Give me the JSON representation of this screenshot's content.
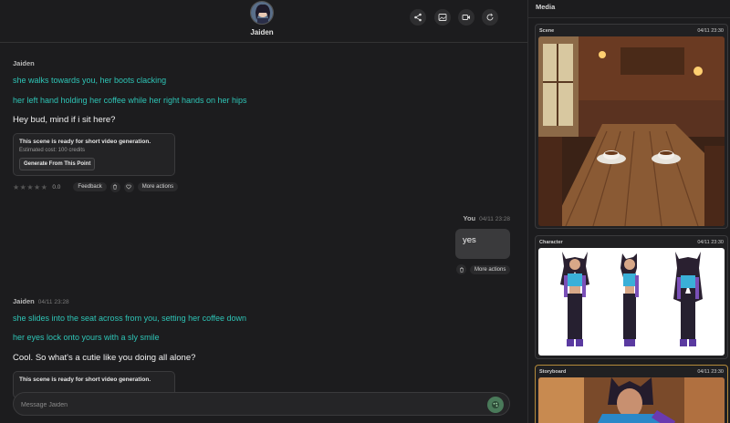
{
  "header": {
    "character_name": "Jaiden",
    "icons": [
      "share-icon",
      "image-icon",
      "video-icon",
      "refresh-icon"
    ]
  },
  "messages": {
    "first": {
      "author": "Jaiden",
      "narration_1": "she walks towards you, her boots clacking",
      "narration_2": "her left hand holding her coffee while her right hands on her hips",
      "speech": "Hey bud, mind if i sit here?",
      "card": {
        "title": "This scene is ready for short video generation.",
        "cost": "Estimated cost: 100 credits",
        "button": "Generate From This Point"
      },
      "rating": "0.0",
      "feedback_label": "Feedback",
      "more_actions_label": "More actions"
    },
    "user": {
      "author": "You",
      "timestamp": "04/11 23:28",
      "text": "yes",
      "more_actions_label": "More actions"
    },
    "second": {
      "author": "Jaiden",
      "timestamp": "04/11 23:28",
      "narration_1": "she slides into the seat across from you, setting her coffee down",
      "narration_2": "her eyes lock onto yours with a sly smile",
      "speech": "Cool. So what's a cutie like you doing all alone?",
      "card_title": "This scene is ready for short video generation."
    }
  },
  "composer": {
    "placeholder": "Message Jaiden"
  },
  "media": {
    "title": "Media",
    "items": [
      {
        "label": "Scene",
        "timestamp": "04/11 23:30"
      },
      {
        "label": "Character",
        "timestamp": "04/11 23:30"
      },
      {
        "label": "Storyboard",
        "timestamp": "04/11 23:30"
      }
    ]
  },
  "colors": {
    "narration": "#2ec4b6",
    "background": "#1c1c1e",
    "active_border": "#b48a3a"
  }
}
